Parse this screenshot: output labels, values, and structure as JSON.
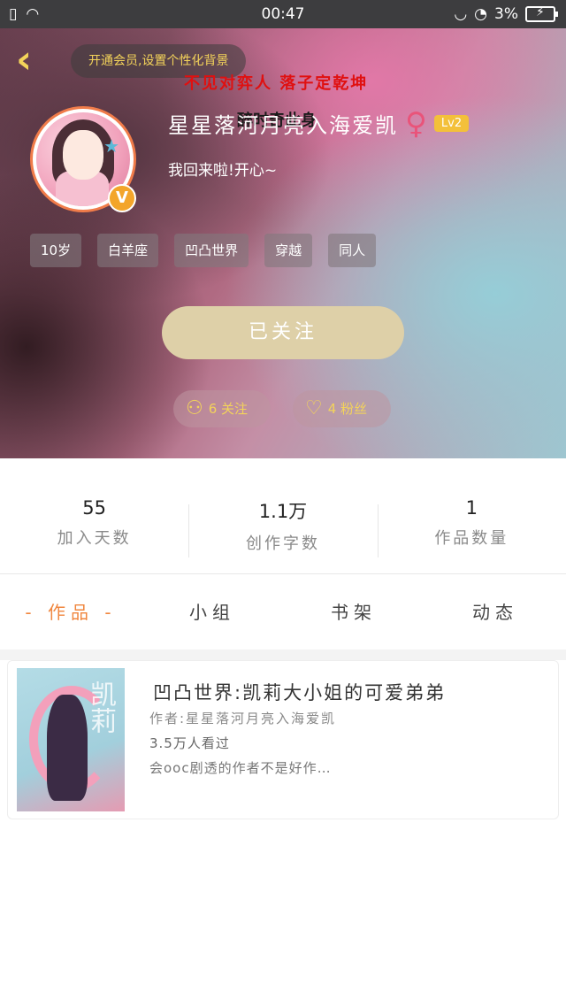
{
  "status_bar": {
    "time": "00:47",
    "battery": "3%",
    "icons": [
      "sim-icon",
      "wifi-icon",
      "headset-icon",
      "alarm-icon",
      "battery-icon"
    ]
  },
  "header": {
    "vip_prompt": "开通会员,设置个性化背景",
    "overlay_text": "不见对弈人 落子定乾坤",
    "overlay_sub": "醉时奇此身",
    "username": "星星落河月亮入海爱凯",
    "gender_symbol": "♀",
    "level": "Lv2",
    "signature": "我回来啦!开心~",
    "avatar_badge": "V",
    "tags": [
      "10岁",
      "白羊座",
      "凹凸世界",
      "穿越",
      "同人"
    ],
    "follow_button": "已关注",
    "following_count": "6 关注",
    "fans_count": "4 粉丝",
    "colors": {
      "accent_gold": "#f3d35a",
      "follow_button_bg": "#ded0a8",
      "gender": "#e9547a"
    }
  },
  "stats": [
    {
      "value": "55",
      "label": "加入天数"
    },
    {
      "value": "1.1万",
      "label": "创作字数"
    },
    {
      "value": "1",
      "label": "作品数量"
    }
  ],
  "tabs": [
    {
      "label": "作品",
      "active": true
    },
    {
      "label": "小组",
      "active": false
    },
    {
      "label": "书架",
      "active": false
    },
    {
      "label": "动态",
      "active": false
    }
  ],
  "works": [
    {
      "title": "凹凸世界:凯莉大小姐的可爱弟弟",
      "author": "作者:星星落河月亮入海爱凯",
      "reads": "3.5万人看过",
      "description": "会ooc剧透的作者不是好作…",
      "cover_text": "凯莉"
    }
  ],
  "colors": {
    "active_tab": "#f0863e"
  }
}
